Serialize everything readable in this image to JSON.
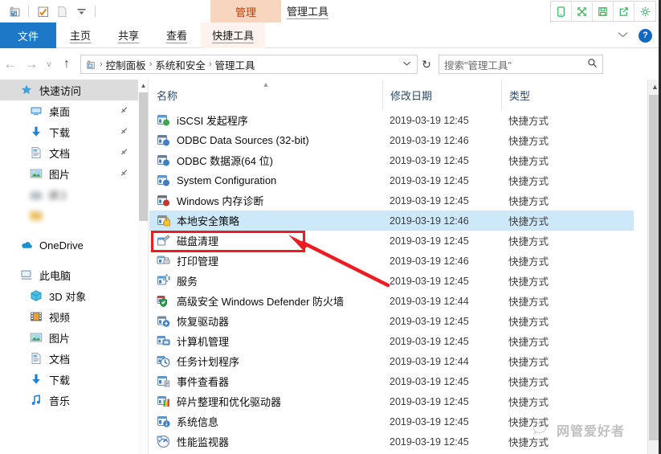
{
  "window": {
    "title": "管理工具",
    "contextual_tab": "管理"
  },
  "quick_access_toolbar": {
    "items": [
      {
        "name": "properties-icon",
        "label": "属性"
      },
      {
        "name": "new-folder-icon",
        "label": "新建文件夹"
      },
      {
        "name": "file-icon",
        "label": "文件"
      },
      {
        "name": "customize-dropdown-icon",
        "label": "自定义快速访问工具栏"
      }
    ]
  },
  "capture_toolbar": {
    "buttons": [
      {
        "name": "mobile-icon",
        "label": "手机"
      },
      {
        "name": "fullscreen-icon",
        "label": "全屏"
      },
      {
        "name": "save-icon",
        "label": "保存"
      },
      {
        "name": "share-icon",
        "label": "分享"
      },
      {
        "name": "settings-gear-icon",
        "label": "设置"
      }
    ],
    "color": "#21b24b"
  },
  "ribbon": {
    "tabs": [
      {
        "label": "文件",
        "active": true
      },
      {
        "label": "主页",
        "active": false
      },
      {
        "label": "共享",
        "active": false
      },
      {
        "label": "查看",
        "active": false
      },
      {
        "label": "快捷工具",
        "active": false,
        "contextual": true
      }
    ],
    "collapse_label": "∨",
    "help_label": "?",
    "accent": "#1e78c8"
  },
  "address_bar": {
    "back_label": "←",
    "forward_label": "→",
    "recent_label": "∨",
    "up_label": "↑",
    "breadcrumbs": [
      "控制面板",
      "系统和安全",
      "管理工具"
    ],
    "separator": "›",
    "dropdown_label": "∨",
    "refresh_label": "↻"
  },
  "search": {
    "placeholder": "搜索\"管理工具\"",
    "value": "",
    "icon": "search-icon"
  },
  "sidebar": {
    "items": [
      {
        "label": "快速访问",
        "icon": "star-pin-icon",
        "selected": true,
        "pinned": false,
        "indent": 0,
        "blurred": false
      },
      {
        "label": "桌面",
        "icon": "desktop-icon",
        "selected": false,
        "pinned": true,
        "indent": 1,
        "blurred": false
      },
      {
        "label": "下载",
        "icon": "download-icon",
        "selected": false,
        "pinned": true,
        "indent": 1,
        "blurred": false
      },
      {
        "label": "文档",
        "icon": "document-icon",
        "selected": false,
        "pinned": true,
        "indent": 1,
        "blurred": false
      },
      {
        "label": "图片",
        "icon": "pictures-icon",
        "selected": false,
        "pinned": true,
        "indent": 1,
        "blurred": false
      },
      {
        "label": "(E:)",
        "icon": "drive-icon",
        "selected": false,
        "pinned": false,
        "indent": 1,
        "blurred": true
      },
      {
        "label": "",
        "icon": "folder-icon",
        "selected": false,
        "pinned": false,
        "indent": 1,
        "blurred": true
      },
      {
        "label": "OneDrive",
        "icon": "onedrive-icon",
        "selected": false,
        "pinned": false,
        "indent": 0,
        "blurred": false
      },
      {
        "label": "此电脑",
        "icon": "this-pc-icon",
        "selected": false,
        "pinned": false,
        "indent": 0,
        "blurred": false
      },
      {
        "label": "3D 对象",
        "icon": "3d-objects-icon",
        "selected": false,
        "pinned": false,
        "indent": 1,
        "blurred": false
      },
      {
        "label": "视频",
        "icon": "videos-icon",
        "selected": false,
        "pinned": false,
        "indent": 1,
        "blurred": false
      },
      {
        "label": "图片",
        "icon": "pictures-icon",
        "selected": false,
        "pinned": false,
        "indent": 1,
        "blurred": false
      },
      {
        "label": "文档",
        "icon": "document-icon",
        "selected": false,
        "pinned": false,
        "indent": 1,
        "blurred": false
      },
      {
        "label": "下载",
        "icon": "download-icon",
        "selected": false,
        "pinned": false,
        "indent": 1,
        "blurred": false
      },
      {
        "label": "音乐",
        "icon": "music-icon",
        "selected": false,
        "pinned": false,
        "indent": 1,
        "blurred": false
      }
    ]
  },
  "file_list": {
    "columns": [
      {
        "label": "名称",
        "sorted": "asc"
      },
      {
        "label": "修改日期",
        "sorted": ""
      },
      {
        "label": "类型",
        "sorted": ""
      }
    ],
    "rows": [
      {
        "name": "iSCSI 发起程序",
        "date": "2019-03-19 12:45",
        "type": "快捷方式",
        "icon": "iscsi-shortcut-icon",
        "selected": false
      },
      {
        "name": "ODBC Data Sources (32-bit)",
        "date": "2019-03-19 12:46",
        "type": "快捷方式",
        "icon": "odbc-shortcut-icon",
        "selected": false
      },
      {
        "name": "ODBC 数据源(64 位)",
        "date": "2019-03-19 12:45",
        "type": "快捷方式",
        "icon": "odbc-shortcut-icon",
        "selected": false
      },
      {
        "name": "System Configuration",
        "date": "2019-03-19 12:45",
        "type": "快捷方式",
        "icon": "sysconfig-shortcut-icon",
        "selected": false
      },
      {
        "name": "Windows 内存诊断",
        "date": "2019-03-19 12:45",
        "type": "快捷方式",
        "icon": "memory-diagnostic-icon",
        "selected": false
      },
      {
        "name": "本地安全策略",
        "date": "2019-03-19 12:46",
        "type": "快捷方式",
        "icon": "local-security-policy-icon",
        "selected": true
      },
      {
        "name": "磁盘清理",
        "date": "2019-03-19 12:45",
        "type": "快捷方式",
        "icon": "disk-cleanup-icon",
        "selected": false
      },
      {
        "name": "打印管理",
        "date": "2019-03-19 12:46",
        "type": "快捷方式",
        "icon": "print-management-icon",
        "selected": false
      },
      {
        "name": "服务",
        "date": "2019-03-19 12:45",
        "type": "快捷方式",
        "icon": "services-icon",
        "selected": false
      },
      {
        "name": "高级安全 Windows Defender 防火墙",
        "date": "2019-03-19 12:44",
        "type": "快捷方式",
        "icon": "firewall-icon",
        "selected": false
      },
      {
        "name": "恢复驱动器",
        "date": "2019-03-19 12:45",
        "type": "快捷方式",
        "icon": "recovery-drive-icon",
        "selected": false
      },
      {
        "name": "计算机管理",
        "date": "2019-03-19 12:45",
        "type": "快捷方式",
        "icon": "computer-management-icon",
        "selected": false
      },
      {
        "name": "任务计划程序",
        "date": "2019-03-19 12:44",
        "type": "快捷方式",
        "icon": "task-scheduler-icon",
        "selected": false
      },
      {
        "name": "事件查看器",
        "date": "2019-03-19 12:45",
        "type": "快捷方式",
        "icon": "event-viewer-icon",
        "selected": false
      },
      {
        "name": "碎片整理和优化驱动器",
        "date": "2019-03-19 12:45",
        "type": "快捷方式",
        "icon": "defrag-icon",
        "selected": false
      },
      {
        "name": "系统信息",
        "date": "2019-03-19 12:45",
        "type": "快捷方式",
        "icon": "system-info-icon",
        "selected": false
      },
      {
        "name": "性能监视器",
        "date": "2019-03-19 12:45",
        "type": "快捷方式",
        "icon": "performance-monitor-icon",
        "selected": false
      }
    ]
  },
  "annotation": {
    "highlight_color": "#ee1c22",
    "target_row": "本地安全策略"
  },
  "watermark": {
    "text": "网管爱好者",
    "icon": "wechat-icon"
  }
}
